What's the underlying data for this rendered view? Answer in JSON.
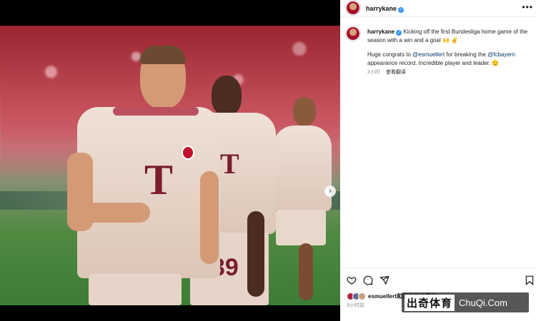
{
  "post": {
    "username": "harrykane",
    "caption_line1": "Kicking off the first Bundesliga home game of the season with a win and a goal 🙌 ✌️",
    "caption_congrats_prefix": "Huge congrats to ",
    "mention_1": "@esmuellert",
    "caption_middle": " for breaking the ",
    "mention_2": "@fcbayern",
    "caption_end": " appearance record. Incredible player and leader. 🫡",
    "time_ago": "3小时",
    "translate_label": "查看翻译"
  },
  "photo": {
    "shirt_logo": "T",
    "shirt_number": "39"
  },
  "likes": {
    "text": "esmuellert和其他用户赞了",
    "time": "3小时前"
  },
  "watermark": {
    "cn": "出奇体育",
    "en": "ChuQi.Com"
  },
  "icons": {
    "like": "heart-icon",
    "comment": "comment-icon",
    "share": "share-icon",
    "save": "bookmark-icon",
    "more": "more-icon",
    "tag": "user-tag-icon",
    "next": "chevron-right-icon"
  },
  "colors": {
    "bayern_red": "#a6112b",
    "link_blue": "#00376b",
    "verified_blue": "#3897f0"
  }
}
